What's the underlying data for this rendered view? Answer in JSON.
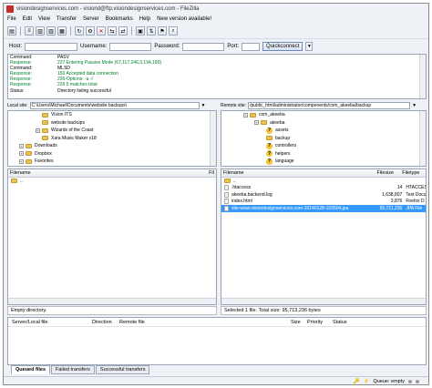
{
  "window": {
    "title": "visiondesignservices.com - visiond@ftp.visiondesignservices.com - FileZilla"
  },
  "menu": [
    "File",
    "Edit",
    "View",
    "Transfer",
    "Server",
    "Bookmarks",
    "Help",
    "New version available!"
  ],
  "quickconnect": {
    "host_label": "Host:",
    "username_label": "Username:",
    "password_label": "Password:",
    "port_label": "Port:",
    "button_label": "Quickconnect"
  },
  "log": [
    {
      "k": "Command:",
      "v": "PASV",
      "color": "#000000"
    },
    {
      "k": "Response:",
      "v": "227 Entering Passive Mode (67,117,246,3,194,180)",
      "color": "#00802b"
    },
    {
      "k": "Command:",
      "v": "MLSD",
      "color": "#000000"
    },
    {
      "k": "Response:",
      "v": "150 Accepted data connection",
      "color": "#00802b"
    },
    {
      "k": "Response:",
      "v": "226-Options: -a -l",
      "color": "#00802b"
    },
    {
      "k": "Response:",
      "v": "226 5 matches total",
      "color": "#00802b"
    },
    {
      "k": "Status:",
      "v": "Directory listing successful",
      "color": "#000000"
    }
  ],
  "local": {
    "site_label": "Local site:",
    "path": "C:\\Users\\Michael\\Documents\\website backups\\",
    "tree": [
      {
        "label": "Vision ITS",
        "indent": 5,
        "exp": false
      },
      {
        "label": "website backups",
        "indent": 5,
        "exp": false
      },
      {
        "label": "Wizards of the Coast",
        "indent": 5,
        "exp": true
      },
      {
        "label": "Xara Music Maker v18",
        "indent": 5,
        "exp": false
      },
      {
        "label": "Downloads",
        "indent": 2,
        "exp": true
      },
      {
        "label": "Dropbox",
        "indent": 2,
        "exp": true
      },
      {
        "label": "Favorites",
        "indent": 2,
        "exp": true
      }
    ],
    "headers": [
      "Filename",
      "Fil"
    ],
    "rows": [
      ".."
    ],
    "status": "Empty directory."
  },
  "remote": {
    "site_label": "Remote site:",
    "path": "/public_html/administrator/components/com_akeeba/backup",
    "tree": [
      {
        "label": "com_akeeba",
        "indent": 4,
        "icon": "folder",
        "exp": true
      },
      {
        "label": "akeeba",
        "indent": 6,
        "icon": "folder",
        "exp": true
      },
      {
        "label": "assets",
        "indent": 7,
        "icon": "question",
        "exp": false
      },
      {
        "label": "backup",
        "indent": 7,
        "icon": "folder",
        "exp": false
      },
      {
        "label": "controllers",
        "indent": 7,
        "icon": "question",
        "exp": false
      },
      {
        "label": "helpers",
        "indent": 7,
        "icon": "question",
        "exp": false
      },
      {
        "label": "language",
        "indent": 7,
        "icon": "question",
        "exp": false
      }
    ],
    "headers": [
      "Filename",
      "Filesize",
      "Filetype"
    ],
    "rows": [
      {
        "name": "..",
        "size": "",
        "type": "",
        "sel": false
      },
      {
        "name": ".htaccess",
        "size": "14",
        "type": "HTACCESS",
        "sel": false
      },
      {
        "name": "akeeba.backend.log",
        "size": "1,638,807",
        "type": "Text Docu",
        "sel": false
      },
      {
        "name": "index.html",
        "size": "3,876",
        "type": "Firefox D",
        "sel": false
      },
      {
        "name": "site-www.visiondesignservices.com-20140128-103504.jpa",
        "size": "95,711,236",
        "type": "JPA File",
        "sel": true
      }
    ],
    "status": "Selected 1 file. Total size: 95,713,236 bytes"
  },
  "queue": {
    "headers": [
      "Server/Local file",
      "Direction",
      "Remote file",
      "Size",
      "Priority",
      "Status"
    ],
    "tabs": [
      "Queued files",
      "Failed transfers",
      "Successful transfers"
    ],
    "status": "Queue: empty"
  }
}
